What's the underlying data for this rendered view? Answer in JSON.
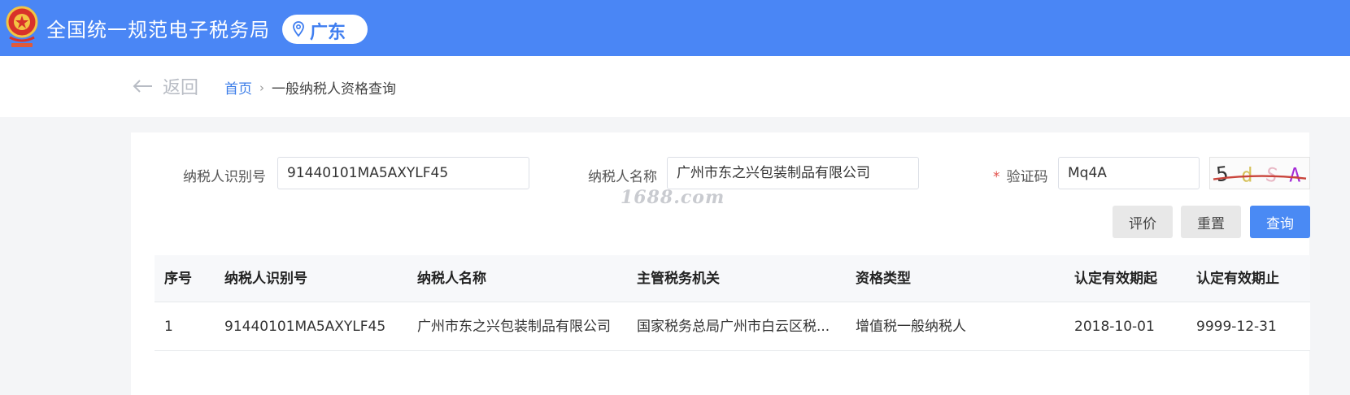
{
  "header": {
    "title": "全国统一规范电子税务局",
    "region": "广东",
    "emblem_icon": "tax-emblem-icon",
    "pin_icon": "location-pin-icon"
  },
  "nav": {
    "back_label": "返回",
    "breadcrumb": {
      "home": "首页",
      "separator": "›",
      "current": "一般纳税人资格查询"
    }
  },
  "form": {
    "taxpayer_id": {
      "label": "纳税人识别号",
      "value": "91440101MA5AXYLF45"
    },
    "taxpayer_name": {
      "label": "纳税人名称",
      "value": "广州市东之兴包装制品有限公司"
    },
    "captcha": {
      "required_mark": "*",
      "label": "验证码",
      "value": "Mq4A",
      "image_text": "5dSA"
    },
    "buttons": {
      "rate": "评价",
      "reset": "重置",
      "query": "查询"
    }
  },
  "watermark": "1688.com",
  "table": {
    "columns": [
      "序号",
      "纳税人识别号",
      "纳税人名称",
      "主管税务机关",
      "资格类型",
      "认定有效期起",
      "认定有效期止"
    ],
    "rows": [
      [
        "1",
        "91440101MA5AXYLF45",
        "广州市东之兴包装制品有限公司",
        "国家税务总局广州市白云区税...",
        "增值税一般纳税人",
        "2018-10-01",
        "9999-12-31"
      ]
    ]
  },
  "colors": {
    "header_bg": "#4a86f5",
    "primary": "#4a8af4",
    "link": "#3d7ee8",
    "required": "#e2504a"
  }
}
